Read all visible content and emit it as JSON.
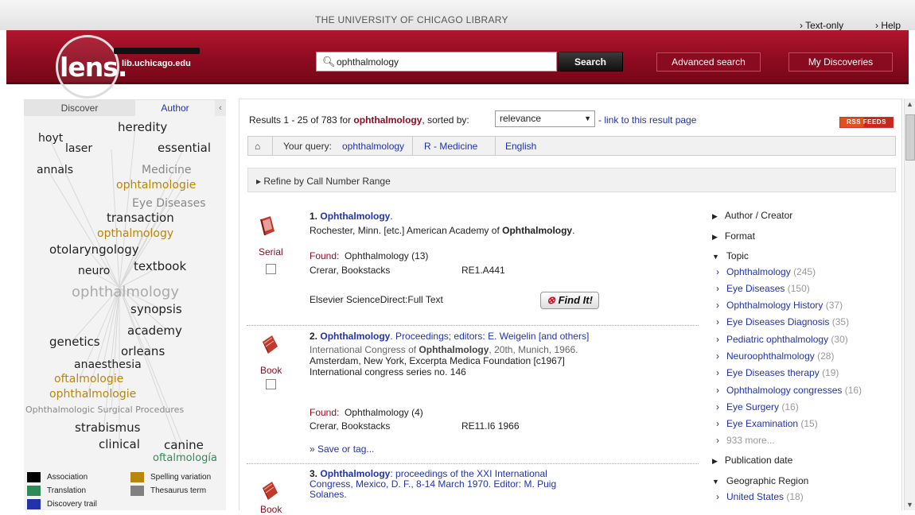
{
  "header": {
    "library_name": "THE UNIVERSITY OF CHICAGO LIBRARY",
    "text_only": "› Text-only",
    "help": "› Help",
    "logo_text": "lens.",
    "logo_url": "lib.uchicago.edu",
    "search_value": "ophthalmology",
    "search_button": "Search",
    "advanced_search": "Advanced search",
    "my_discoveries": "My Discoveries"
  },
  "sidebar": {
    "tab_discover": "Discover",
    "tab_author": "Author",
    "collapse": "‹",
    "cloud": [
      {
        "text": "heredity",
        "color": "#222"
      },
      {
        "text": "hoyt",
        "color": "#222"
      },
      {
        "text": "laser",
        "color": "#222"
      },
      {
        "text": "essential",
        "color": "#222"
      },
      {
        "text": "annals",
        "color": "#222"
      },
      {
        "text": "Medicine",
        "color": "#888"
      },
      {
        "text": "ophtalmologie",
        "color": "#b8860b"
      },
      {
        "text": "Eye Diseases",
        "color": "#888"
      },
      {
        "text": "transaction",
        "color": "#222"
      },
      {
        "text": "opthalmology",
        "color": "#b8860b"
      },
      {
        "text": "otolaryngology",
        "color": "#222"
      },
      {
        "text": "textbook",
        "color": "#222"
      },
      {
        "text": "neuro",
        "color": "#222"
      },
      {
        "text": "ophthalmology",
        "color": "#aaa"
      },
      {
        "text": "synopsis",
        "color": "#222"
      },
      {
        "text": "academy",
        "color": "#222"
      },
      {
        "text": "genetics",
        "color": "#222"
      },
      {
        "text": "orleans",
        "color": "#222"
      },
      {
        "text": "anaesthesia",
        "color": "#222"
      },
      {
        "text": "oftalmologie",
        "color": "#b8860b"
      },
      {
        "text": "ophthalmologie",
        "color": "#b8860b"
      },
      {
        "text": "Ophthalmologic Surgical Procedures",
        "color": "#888"
      },
      {
        "text": "strabismus",
        "color": "#222"
      },
      {
        "text": "clinical",
        "color": "#222"
      },
      {
        "text": "canine",
        "color": "#222"
      },
      {
        "text": "oftalmología",
        "color": "#2e8b57"
      }
    ],
    "legend": [
      {
        "label": "Association",
        "color": "#000000"
      },
      {
        "label": "Spelling variation",
        "color": "#b8860b"
      },
      {
        "label": "Translation",
        "color": "#2e8b57"
      },
      {
        "label": "Thesaurus term",
        "color": "#808080"
      },
      {
        "label": "Discovery trail",
        "color": "#2233aa"
      }
    ]
  },
  "results": {
    "prefix": "Results 1 - 25 of 783 for ",
    "query": "ophthalmology",
    "suffix": ", sorted by:",
    "sort_value": "relevance",
    "link_text": "- link to this result page",
    "rss": "RSS FEEDS",
    "breadcrumb": {
      "home_icon": "home-icon",
      "query_label": "Your query:",
      "query_link": "ophthalmology",
      "crumb2": "R - Medicine",
      "crumb3": "English"
    },
    "refine": "▸  Refine by Call Number Range",
    "records": [
      {
        "num": "1.",
        "title": "Ophthalmology",
        "title_rest": ".",
        "type": "Serial",
        "publisher_a": "Rochester, Minn. [etc.] American Academy of ",
        "publisher_b": "Ophthalmology",
        "publisher_c": ".",
        "found_label": "Found:",
        "found_value": "Ophthalmology (13)",
        "location": "Crerar, Bookstacks",
        "callno": "RE1.A441",
        "fulltext": "Elsevier ScienceDirect:Full Text",
        "findit": "Find It!"
      },
      {
        "num": "2.",
        "title": "Ophthalmology",
        "title_rest": ". Proceedings; editors: E. Weigelin [and others]",
        "type": "Book",
        "author_a": "International Congress of ",
        "author_b": "Ophthalmology",
        "author_c": ", 20th, Munich, 1966.",
        "publisher": "Amsterdam, New York, Excerpta Medica Foundation [c1967]",
        "series": "International congress series no. 146",
        "found_label": "Found:",
        "found_value": "Ophthalmology (4)",
        "location": "Crerar, Bookstacks",
        "callno": "RE11.I6 1966",
        "save": "» Save or tag..."
      },
      {
        "num": "3.",
        "title": "Ophthalmology",
        "title_rest": ": proceedings of the XXI International Congress, Mexico, D. F., 8-14 March 1970. Editor: M. Puig Solanes.",
        "type": "Book"
      }
    ]
  },
  "facets": {
    "headers": [
      "Author / Creator",
      "Format",
      "Topic",
      "Publication date",
      "Geographic Region"
    ],
    "topic_items": [
      {
        "label": "Ophthalmology",
        "count": "(245)"
      },
      {
        "label": "Eye Diseases",
        "count": "(150)"
      },
      {
        "label": "Ophthalmology History",
        "count": "(37)"
      },
      {
        "label": "Eye Diseases Diagnosis",
        "count": "(35)"
      },
      {
        "label": "Pediatric ophthalmology",
        "count": "(30)"
      },
      {
        "label": "Neuroophthalmology",
        "count": "(28)"
      },
      {
        "label": "Eye Diseases therapy",
        "count": "(19)"
      },
      {
        "label": "Ophthalmology congresses",
        "count": "(16)"
      },
      {
        "label": "Eye Surgery",
        "count": "(16)"
      },
      {
        "label": "Eye Examination",
        "count": "(15)"
      },
      {
        "label": "933 more...",
        "count": ""
      }
    ],
    "region_items": [
      {
        "label": "United States",
        "count": "(18)"
      }
    ]
  }
}
